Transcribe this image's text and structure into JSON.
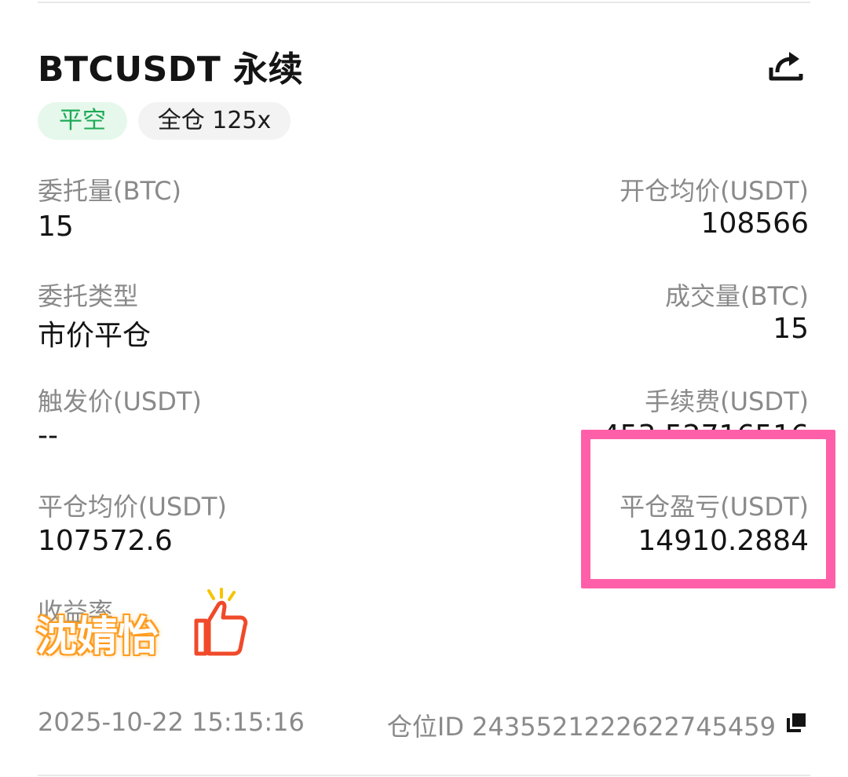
{
  "header": {
    "title": "BTCUSDT 永续",
    "share_icon": "share-icon"
  },
  "tags": {
    "side": "平空",
    "margin": "全仓 125x"
  },
  "fields": {
    "order_qty_label": "委托量(BTC)",
    "order_qty_value": "15",
    "open_avg_label": "开仓均价(USDT)",
    "open_avg_value": "108566",
    "order_type_label": "委托类型",
    "order_type_value": "市价平仓",
    "filled_qty_label": "成交量(BTC)",
    "filled_qty_value": "15",
    "trigger_label": "触发价(USDT)",
    "trigger_value": "--",
    "fee_label": "手续费(USDT)",
    "fee_value": "453.52716516",
    "close_avg_label": "平仓均价(USDT)",
    "close_avg_value": "107572.6",
    "pnl_label": "平仓盈亏(USDT)",
    "pnl_value": "14910.2884",
    "roi_label": "收益率"
  },
  "sticker": {
    "name": "沈婧怡",
    "icon": "thumbs-up-icon"
  },
  "footer": {
    "timestamp": "2025-10-22  15:15:16",
    "position_id": "仓位ID 2435521222622745459",
    "copy_icon": "copy-icon"
  },
  "colors": {
    "accent_green": "#1eaa56",
    "highlight_pink": "#ff5fa8",
    "sticker_orange": "#ff9d21"
  }
}
